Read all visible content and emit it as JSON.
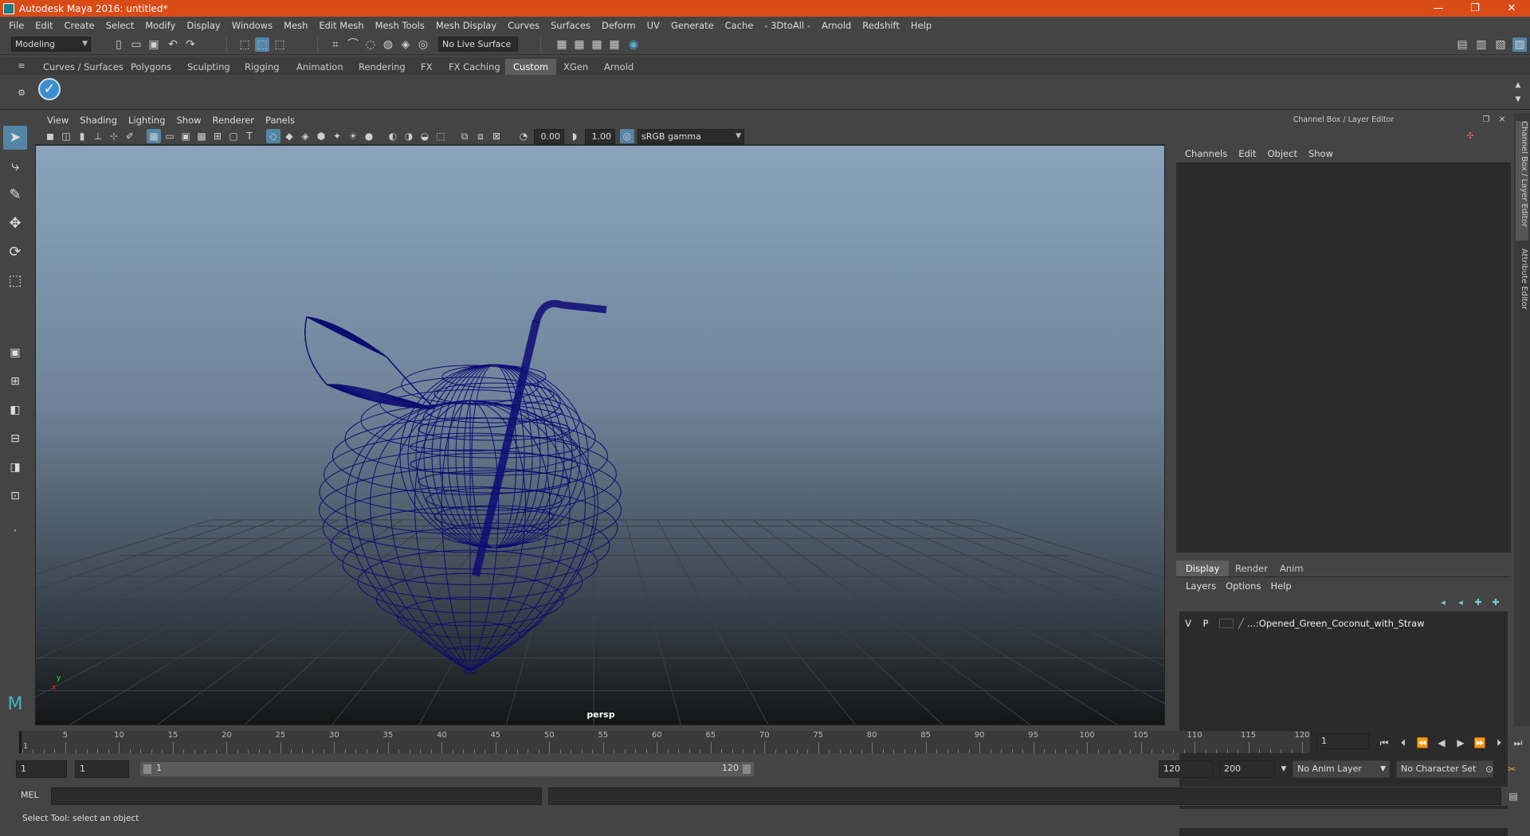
{
  "window": {
    "title": "Autodesk Maya 2016: untitled*",
    "minimize": "—",
    "restore": "❐",
    "close": "✕"
  },
  "menus": [
    "File",
    "Edit",
    "Create",
    "Select",
    "Modify",
    "Display",
    "Windows",
    "Mesh",
    "Edit Mesh",
    "Mesh Tools",
    "Mesh Display",
    "Curves",
    "Surfaces",
    "Deform",
    "UV",
    "Generate",
    "Cache",
    "- 3DtoAll -",
    "Arnold",
    "Redshift",
    "Help"
  ],
  "status_line": {
    "menu_set": "Modeling",
    "live_surface": "No Live Surface"
  },
  "shelf": {
    "tabs": [
      "Curves / Surfaces",
      "Polygons",
      "Sculpting",
      "Rigging",
      "Animation",
      "Rendering",
      "FX",
      "FX Caching",
      "Custom",
      "XGen",
      "Arnold"
    ],
    "active_tab": "Custom"
  },
  "viewport": {
    "menus": [
      "View",
      "Shading",
      "Lighting",
      "Show",
      "Renderer",
      "Panels"
    ],
    "exposure": "0.00",
    "gamma": "1.00",
    "color_space": "sRGB gamma",
    "camera_label": "persp",
    "wire_color": "#0c0c73",
    "axis_x": "x",
    "axis_y": "y"
  },
  "channel_box": {
    "title": "Channel Box / Layer Editor",
    "menus": [
      "Channels",
      "Edit",
      "Object",
      "Show"
    ]
  },
  "layer_editor": {
    "tabs": [
      "Display",
      "Render",
      "Anim"
    ],
    "active_tab": "Display",
    "menus": [
      "Layers",
      "Options",
      "Help"
    ],
    "layers": [
      {
        "v": "V",
        "p": "P",
        "name": "...:Opened_Green_Coconut_with_Straw"
      }
    ]
  },
  "side_tabs": [
    "Channel Box / Layer Editor",
    "Attribute Editor"
  ],
  "time_slider": {
    "ticks": [
      1,
      5,
      10,
      15,
      20,
      25,
      30,
      35,
      40,
      45,
      50,
      55,
      60,
      65,
      70,
      75,
      80,
      85,
      90,
      95,
      100,
      105,
      110,
      115,
      120
    ],
    "current_frame": "1",
    "min": 1,
    "max": 120
  },
  "range": {
    "start_time": "1",
    "start_range": "1",
    "range_start_label": "1",
    "range_end_label": "120",
    "end_range": "120",
    "end_time": "200",
    "anim_layer": "No Anim Layer",
    "character_set": "No Character Set"
  },
  "command_line": {
    "label": "MEL"
  },
  "help_line": "Select Tool: select an object"
}
